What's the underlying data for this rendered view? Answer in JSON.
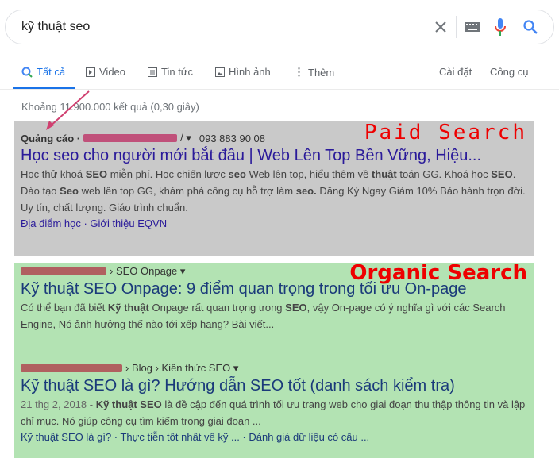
{
  "search": {
    "query": "kỹ thuật seo"
  },
  "tabs": [
    {
      "label": "Tất cả",
      "icon": "search-icon"
    },
    {
      "label": "Video",
      "icon": "play-icon"
    },
    {
      "label": "Tin tức",
      "icon": "news-icon"
    },
    {
      "label": "Hình ảnh",
      "icon": "image-icon"
    },
    {
      "label": "Thêm",
      "icon": "more-icon"
    }
  ],
  "tools": {
    "settings": "Cài đặt",
    "tools": "Công cụ"
  },
  "result_count": "Khoảng 11.900.000 kết quả (0,30 giây)",
  "paid": {
    "label": "Paid Search",
    "ad_label": "Quảng cáo ·",
    "url_tail": "/ ▾",
    "phone": "093 883 90 08",
    "title": "Học seo cho người mới bắt đầu | Web Lên Top Bền Vững, Hiệu...",
    "snippet": [
      {
        "t": "Học thử khoá "
      },
      {
        "t": "SEO",
        "b": 1
      },
      {
        "t": " miễn phí. Học chiến lược "
      },
      {
        "t": "seo",
        "b": 1
      },
      {
        "t": " Web lên top, hiểu thêm về "
      },
      {
        "t": "thuật",
        "b": 1
      },
      {
        "t": " toán GG. Khoá học "
      },
      {
        "t": "SEO",
        "b": 1
      },
      {
        "t": ". Đào tạo "
      },
      {
        "t": "Seo",
        "b": 1
      },
      {
        "t": " web lên top GG, khám phá công cụ hỗ trợ làm "
      },
      {
        "t": "seo.",
        "b": 1
      },
      {
        "t": " Đăng Ký Ngay Giảm 10% Bảo hành trọn đời. Uy tín, chất lượng. Giáo trình chuẩn."
      }
    ],
    "sitelinks": "Địa điểm học · Giới thiệu EQVN"
  },
  "organic": {
    "label": "Organic Search",
    "results": [
      {
        "breadcrumb": "› SEO Onpage ▾",
        "title": "Kỹ thuật SEO Onpage: 9 điểm quan trọng trong tối ưu On-page",
        "snippet": [
          {
            "t": "Có thể bạn đã biết "
          },
          {
            "t": "Kỹ thuật",
            "b": 1
          },
          {
            "t": " Onpage rất quan trọng trong "
          },
          {
            "t": "SEO",
            "b": 1
          },
          {
            "t": ", vậy On-page có ý nghĩa gì với các Search Engine, Nó ảnh hưởng thế nào tới xếp hạng? Bài viết..."
          }
        ]
      },
      {
        "breadcrumb": "› Blog › Kiến thức SEO ▾",
        "title": "Kỹ thuật SEO là gì? Hướng dẫn SEO tốt (danh sách kiểm tra)",
        "snippet": [
          {
            "t": "21 thg 2, 2018 - ",
            "d": 1
          },
          {
            "t": "Kỹ thuật SEO",
            "b": 1
          },
          {
            "t": " là đề cập đến quá trình tối ưu trang web cho giai đoạn thu thập thông tin và lập chỉ mục. Nó giúp công cụ tìm kiếm trong giai đoạn ..."
          }
        ],
        "sitelinks": "Kỹ thuật SEO là gì? · Thực tiễn tốt nhất về kỹ ... · Đánh giá dữ liệu có cấu ..."
      }
    ]
  },
  "colors": {
    "paid_bg": "#c9c9c9",
    "organic_bg": "#b3e3b3",
    "label": "#e00000",
    "accent": "#1a73e8"
  }
}
